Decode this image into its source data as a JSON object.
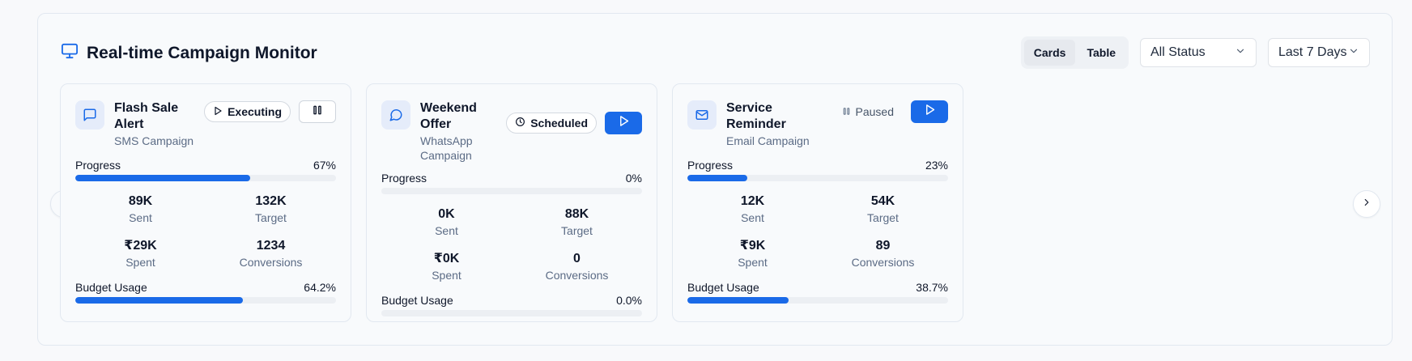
{
  "header": {
    "title": "Real-time Campaign Monitor",
    "icon": "monitor-icon",
    "accent": "#1a6ae8"
  },
  "view_toggle": {
    "options": [
      "Cards",
      "Table"
    ],
    "active": "Cards"
  },
  "status_filter": {
    "value": "All Status"
  },
  "range_filter": {
    "value": "Last 7 Days"
  },
  "labels": {
    "progress": "Progress",
    "budget": "Budget Usage",
    "sent": "Sent",
    "target": "Target",
    "spent": "Spent",
    "conversions": "Conversions"
  },
  "campaigns": [
    {
      "name": "Flash Sale Alert",
      "type": "SMS Campaign",
      "icon": "message-square-icon",
      "status": "Executing",
      "status_icon": "play-icon",
      "action": "pause",
      "progress": 67,
      "progress_text": "67%",
      "sent": "89K",
      "target": "132K",
      "spent": "₹29K",
      "conversions": "1234",
      "budget": 64.2,
      "budget_text": "64.2%"
    },
    {
      "name": "Weekend Offer",
      "type": "WhatsApp Campaign",
      "icon": "message-circle-icon",
      "status": "Scheduled",
      "status_icon": "clock-icon",
      "action": "play",
      "progress": 0,
      "progress_text": "0%",
      "sent": "0K",
      "target": "88K",
      "spent": "₹0K",
      "conversions": "0",
      "budget": 0,
      "budget_text": "0.0%"
    },
    {
      "name": "Service Reminder",
      "type": "Email Campaign",
      "icon": "mail-icon",
      "status": "Paused",
      "status_icon": "pause-icon",
      "action": "play",
      "progress": 23,
      "progress_text": "23%",
      "sent": "12K",
      "target": "54K",
      "spent": "₹9K",
      "conversions": "89",
      "budget": 38.7,
      "budget_text": "38.7%"
    }
  ]
}
